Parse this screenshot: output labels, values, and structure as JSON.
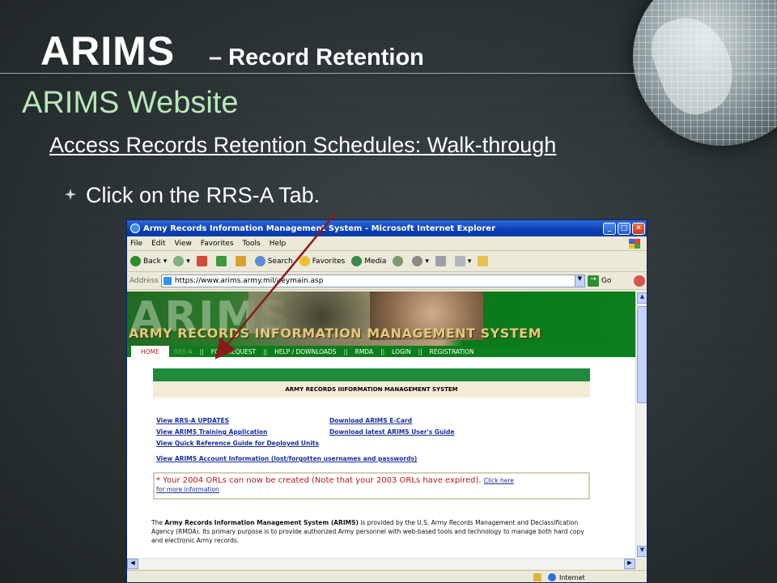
{
  "slide": {
    "title_main": "ARIMS",
    "title_sub": "– Record Retention",
    "section_title": "ARIMS Website",
    "walkthrough_link": "Access Records Retention Schedules: Walk-through",
    "bullet": "Click on the RRS-A Tab.",
    "accent_color": "#b9e8b9"
  },
  "browser": {
    "window_title": "Army Records Information Management System - Microsoft Internet Explorer",
    "menu": [
      "File",
      "Edit",
      "View",
      "Favorites",
      "Tools",
      "Help"
    ],
    "toolbar": {
      "back": "Back",
      "search": "Search",
      "favorites": "Favorites",
      "media": "Media"
    },
    "address": {
      "label": "Address",
      "url": "https://www.arims.army.mil/aeymain.asp",
      "go": "Go"
    },
    "status": {
      "zone": "Internet"
    }
  },
  "site": {
    "ghost_logo": "ARIMS",
    "banner_title": "ARMY RECORDS INFORMATION MANAGEMENT SYSTEM",
    "nav": {
      "home": "HOME",
      "rrsa": "RRS-A",
      "foia": "FOIA REQUEST",
      "help": "HELP / DOWNLOADS",
      "rmda": "RMDA",
      "login": "LOGIN",
      "registration": "REGISTRATION",
      "separator": "||"
    },
    "header_box": "ARMY RECORDS IIIFORMATION MANAGEMENT SYSTEM",
    "links": {
      "rrsa_updates": "View RRS-A UPDATES",
      "training": "View ARIMS Training Application",
      "quick_ref": "View Quick Reference Guide for Deployed Units",
      "ecard": "Download ARIMS E-Card",
      "users_guide": "Download latest ARIMS User's Guide",
      "account": "View ARIMS Account Information (lost/forgotten usernames and passwords)"
    },
    "notice": {
      "text": "* Your 2004 ORLs can now be created (Note that your 2003 ORLs have expired).",
      "click_here": "Click here",
      "more_info": "for more information"
    },
    "about": {
      "lead": "The",
      "bold_name": "Army Records Information Management System (ARIMS)",
      "rest": "is provided by the U.S. Army Records Management and Declassification Agency (RMDA). Its primary purpose is to provide authorized Army personnel with web-based tools and technology to manage both hard copy and electronic Army records."
    }
  }
}
